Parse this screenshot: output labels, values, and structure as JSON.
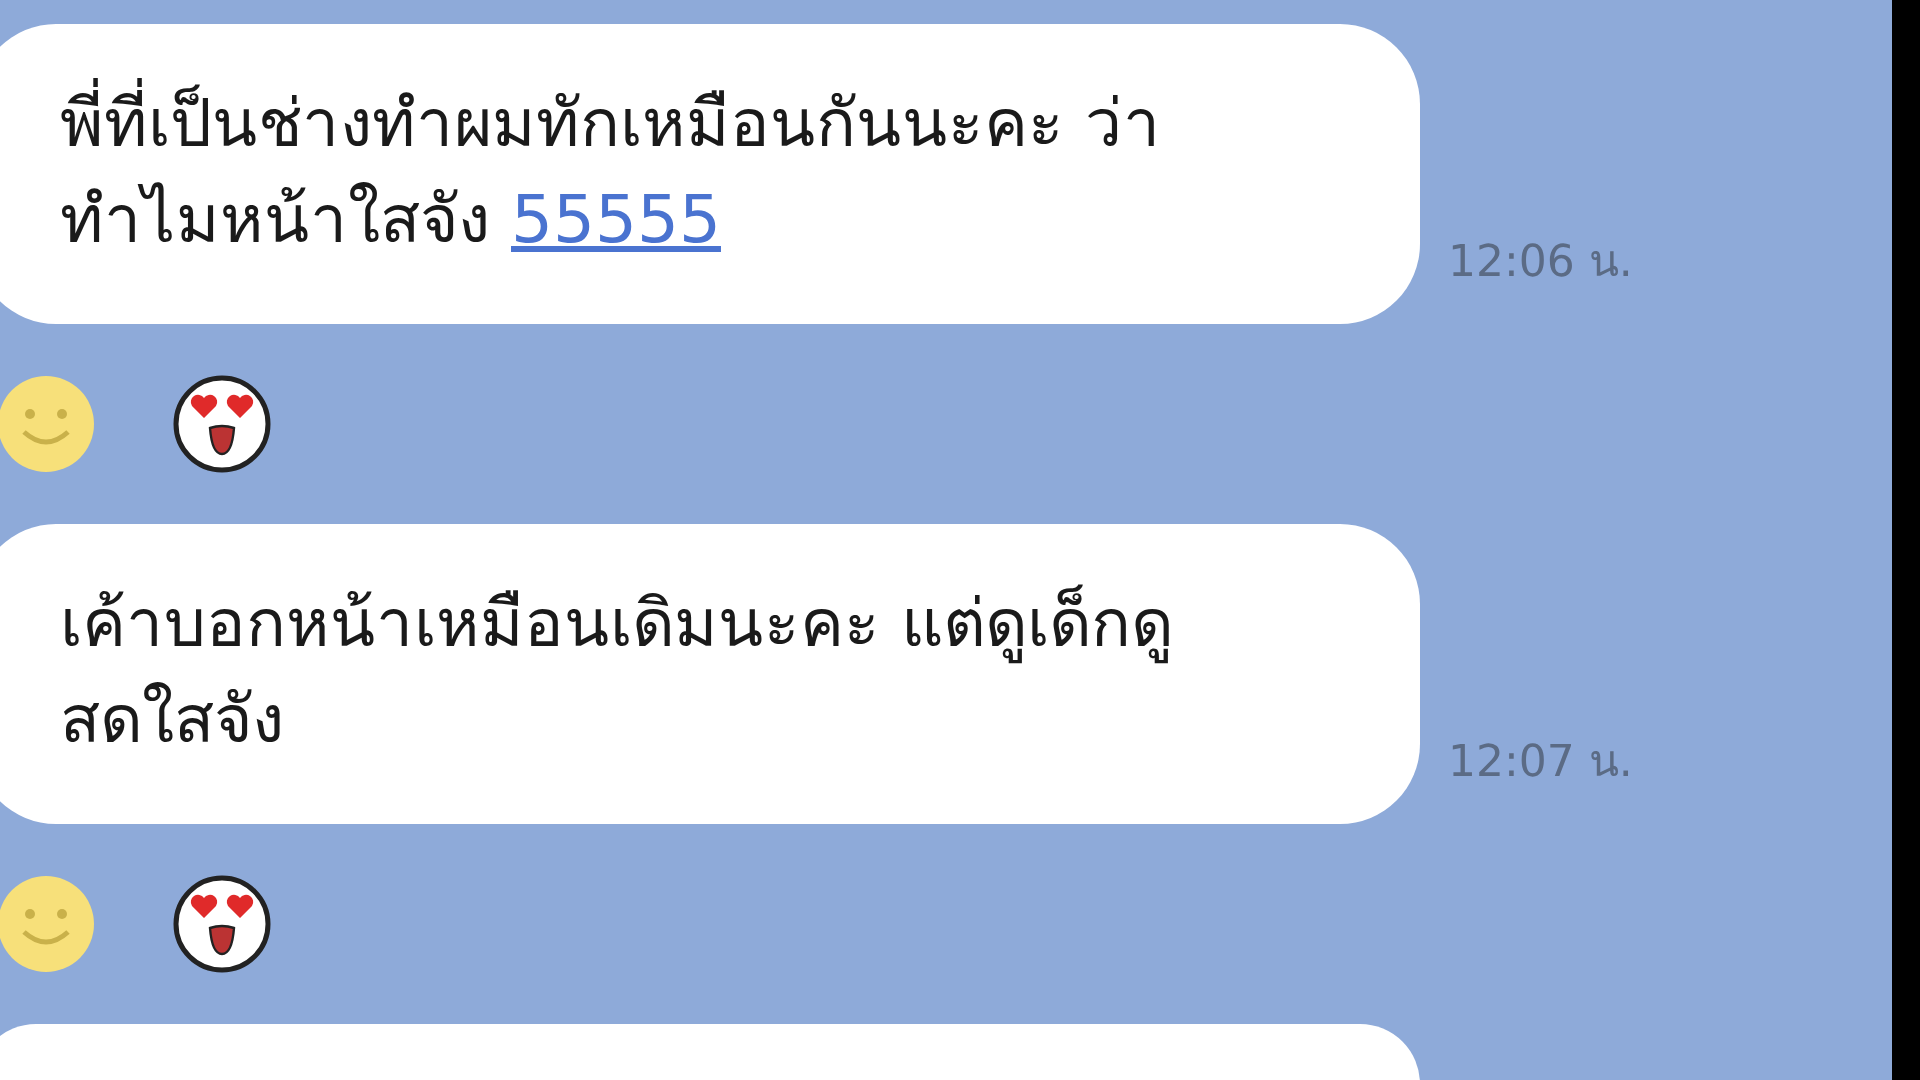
{
  "messages": [
    {
      "lines": [
        "พี่ที่เป็นช่างทำผมทักเหมือนกันนะคะ ว่า",
        "ทำไมหน้าใสจัง"
      ],
      "link": "55555",
      "time": "12:06 น."
    },
    {
      "lines": [
        "เค้าบอกหน้าเหมือนเดิมนะคะ แต่ดูเด็กดู",
        "สดใสจัง"
      ],
      "time": "12:07 น."
    }
  ],
  "partial_bubble": true
}
